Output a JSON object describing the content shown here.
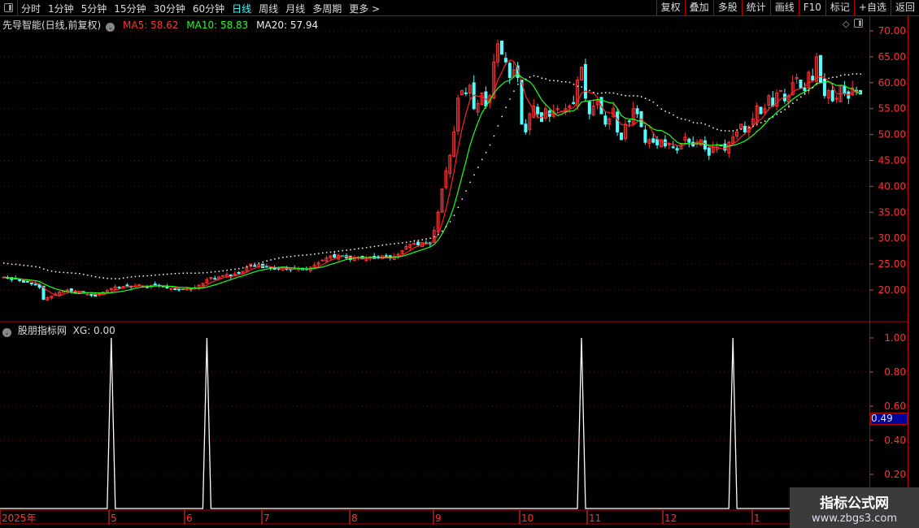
{
  "toolbar": {
    "periods": [
      "分时",
      "1分钟",
      "5分钟",
      "15分钟",
      "30分钟",
      "60分钟",
      "日线",
      "周线",
      "月线",
      "多周期",
      "更多 >"
    ],
    "active_period": "日线",
    "right_buttons": [
      "复权",
      "叠加",
      "多股",
      "统计",
      "画线",
      "F10",
      "标记",
      "+自选",
      "返回"
    ]
  },
  "main": {
    "stock_title": "先导智能(日线,前复权)",
    "ma5_label": "MA5: 58.62",
    "ma10_label": "MA10: 58.83",
    "ma20_label": "MA20: 57.94",
    "price_ticks": [
      "70.00",
      "65.00",
      "60.00",
      "55.00",
      "50.00",
      "45.00",
      "40.00",
      "35.00",
      "30.00",
      "25.00",
      "20.00"
    ]
  },
  "indicator": {
    "title": "股朋指标网",
    "xg_label": "XG: 0.00",
    "ticks": [
      "1.00",
      "0.80",
      "0.60",
      "0.40",
      "0.20"
    ],
    "current_value": "0.49"
  },
  "date_axis": [
    "2025年",
    "5",
    "6",
    "7",
    "8",
    "9",
    "10",
    "11",
    "12",
    "1"
  ],
  "watermark": {
    "line1": "指标公式网",
    "line2": "www.zbgs3.com"
  },
  "colors": {
    "up": "#ff3333",
    "down": "#54ffff",
    "ma5": "#ff2020",
    "ma10": "#20ff20",
    "ma20": "#ffffff",
    "grid": "#8b0000",
    "axis": "#ff3333"
  },
  "chart_data": {
    "type": "candlestick",
    "closes": [
      22.5,
      22.3,
      22.0,
      22.2,
      21.8,
      21.5,
      21.6,
      21.2,
      21.0,
      20.5,
      18.2,
      18.5,
      18.8,
      19.2,
      19.6,
      19.8,
      20.0,
      19.7,
      19.5,
      19.6,
      19.4,
      19.2,
      19.0,
      18.8,
      19.3,
      19.6,
      19.9,
      20.3,
      20.6,
      20.4,
      20.7,
      20.9,
      20.6,
      20.8,
      21.0,
      20.7,
      20.5,
      20.9,
      21.1,
      20.8,
      20.6,
      20.4,
      20.3,
      20.1,
      20.0,
      20.2,
      20.3,
      20.1,
      20.5,
      20.9,
      21.3,
      22.0,
      22.4,
      22.1,
      22.5,
      22.8,
      23.0,
      22.6,
      23.1,
      23.3,
      23.6,
      24.4,
      25.0,
      24.6,
      24.9,
      24.3,
      24.5,
      24.2,
      24.0,
      24.1,
      24.3,
      24.0,
      23.9,
      24.1,
      24.2,
      23.9,
      24.0,
      24.4,
      24.8,
      25.3,
      25.8,
      26.2,
      26.6,
      26.3,
      26.7,
      26.5,
      26.2,
      25.9,
      26.1,
      26.3,
      26.0,
      26.2,
      26.4,
      26.1,
      26.3,
      26.6,
      26.4,
      26.2,
      26.5,
      26.9,
      27.6,
      28.4,
      28.8,
      29.0,
      28.7,
      29.2,
      29.0,
      28.9,
      31.5,
      35.0,
      39.5,
      43.0,
      46.0,
      50.5,
      57.0,
      58.5,
      58.0,
      59.5,
      55.0,
      56.0,
      58.0,
      55.5,
      57.5,
      64.0,
      67.5,
      65.5,
      64.0,
      61.0,
      62.5,
      61.0,
      52.0,
      50.5,
      54.0,
      55.5,
      54.0,
      52.5,
      55.0,
      53.5,
      54.5,
      55.0,
      54.5,
      55.0,
      55.5,
      56.0,
      60.5,
      63.0,
      57.0,
      54.0,
      55.5,
      56.5,
      54.0,
      52.0,
      53.0,
      55.0,
      50.5,
      49.0,
      52.0,
      52.5,
      55.0,
      54.0,
      51.5,
      48.5,
      49.0,
      48.5,
      48.0,
      49.0,
      47.8,
      48.2,
      47.5,
      47.0,
      48.3,
      49.5,
      48.5,
      47.8,
      48.5,
      49.0,
      47.2,
      46.0,
      47.5,
      48.0,
      47.8,
      47.0,
      48.5,
      49.5,
      50.5,
      52.0,
      50.5,
      51.5,
      53.0,
      55.5,
      54.0,
      55.0,
      57.5,
      55.5,
      58.0,
      58.5,
      56.5,
      57.5,
      60.0,
      61.0,
      59.0,
      58.5,
      62.0,
      60.5,
      65.0,
      60.0,
      57.5,
      58.5,
      56.5,
      57.0,
      59.5,
      58.0,
      57.0,
      59.0,
      58.5,
      57.8
    ],
    "ylim": [
      15,
      72
    ],
    "ma_periods": [
      5,
      10,
      20
    ],
    "xg_signal_indices": [
      27,
      51,
      145,
      183
    ],
    "xg_ylim": [
      0,
      1.1
    ]
  }
}
